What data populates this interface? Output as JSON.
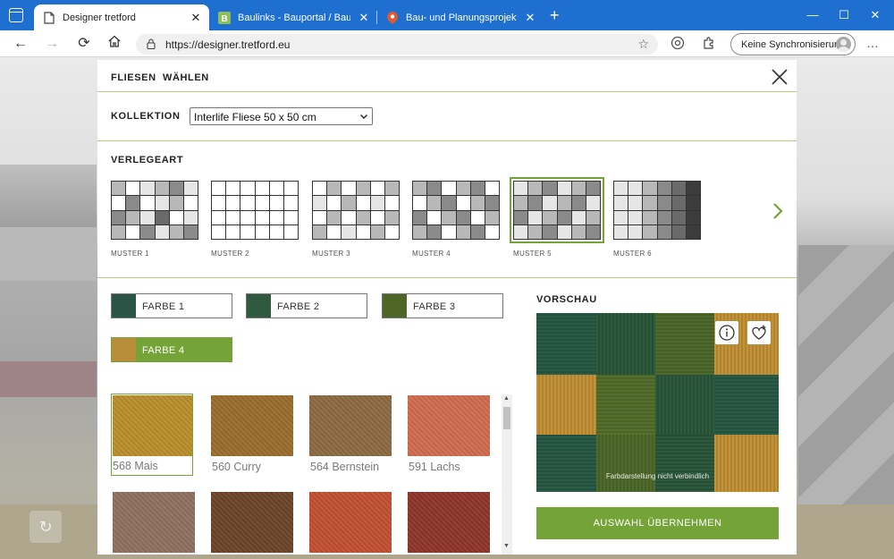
{
  "browser": {
    "tabs": [
      {
        "title": "Designer tretford",
        "active": true,
        "favicon": "tretford-page-icon"
      },
      {
        "title": "Baulinks - Bauportal / Baumagaz",
        "active": false,
        "favicon": "baulinks-b-icon"
      },
      {
        "title": "Bau- und Planungsprojekte auf I",
        "active": false,
        "favicon": "map-pin-icon"
      }
    ],
    "url": "https://designer.tretford.eu",
    "sync_label": "Keine Synchronisierung",
    "colors": {
      "tabbar": "#1f6fd0",
      "accent": "#74a437"
    }
  },
  "modal": {
    "title": "FLIESEN  WÄHLEN",
    "collection_label": "KOLLEKTION",
    "collection_value": "Interlife Fliese 50 x 50 cm",
    "layout_label": "VERLEGEART",
    "patterns": [
      {
        "name": "MUSTER 1",
        "selected": false
      },
      {
        "name": "MUSTER 2",
        "selected": false
      },
      {
        "name": "MUSTER 3",
        "selected": false
      },
      {
        "name": "MUSTER 4",
        "selected": false
      },
      {
        "name": "MUSTER 5",
        "selected": true
      },
      {
        "name": "MUSTER 6",
        "selected": false
      }
    ],
    "color_slots": [
      {
        "label": "FARBE 1",
        "swatch": "#2a5446",
        "active": false
      },
      {
        "label": "FARBE 2",
        "swatch": "#2f5a3f",
        "active": false
      },
      {
        "label": "FARBE 3",
        "swatch": "#4d6628",
        "active": false
      },
      {
        "label": "FARBE 4",
        "swatch": "#b88e3a",
        "active": true
      }
    ],
    "tiles": [
      {
        "name": "568 Mais",
        "color": "#b98d2c",
        "selected": true
      },
      {
        "name": "560 Curry",
        "color": "#9a6c2d",
        "selected": false
      },
      {
        "name": "564 Bernstein",
        "color": "#8c6a40",
        "selected": false
      },
      {
        "name": "591 Lachs",
        "color": "#cf6b50",
        "selected": false
      },
      {
        "name": "",
        "color": "#8f7060",
        "selected": false
      },
      {
        "name": "",
        "color": "#6c4427",
        "selected": false
      },
      {
        "name": "",
        "color": "#c04f32",
        "selected": false
      },
      {
        "name": "",
        "color": "#8e3428",
        "selected": false
      }
    ],
    "preview_label": "VORSCHAU",
    "preview_note": "Farbdarstellung nicht verbindlich",
    "apply_label": "AUSWAHL ÜBERNEHMEN"
  }
}
